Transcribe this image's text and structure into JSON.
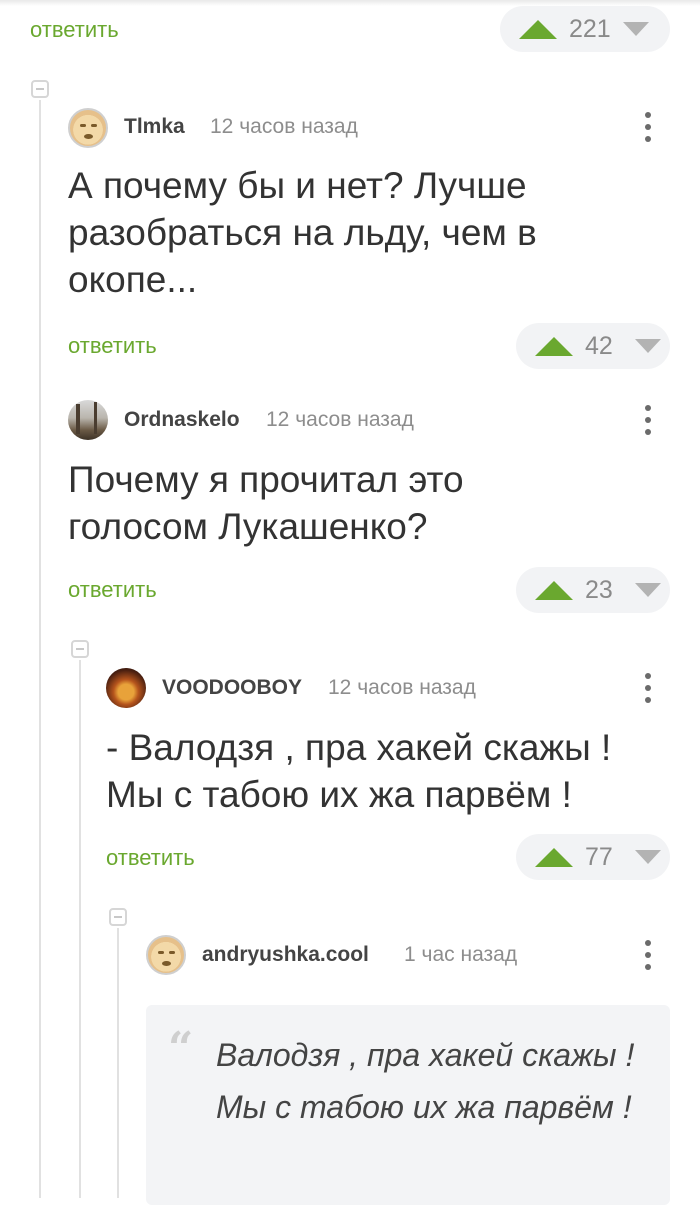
{
  "reply_label": "ответить",
  "colors": {
    "accent_green": "#6aa82f",
    "vote_bg": "#f2f3f5",
    "quote_bg": "#f3f4f6"
  },
  "top": {
    "votes": "221"
  },
  "comments": [
    {
      "user": "Tlmka",
      "time": "12 часов назад",
      "text": "А почему бы и нет? Лучше разобраться на льду, чем в окопе...",
      "votes": "42",
      "avatar_icon": "sleepy-face-avatar"
    },
    {
      "user": "Ordnaskelo",
      "time": "12 часов назад",
      "text": "Почему я прочитал это голосом Лукашенко?",
      "votes": "23",
      "avatar_icon": "forest-photo-avatar"
    },
    {
      "user": "VOODOOBOY",
      "time": "12 часов назад",
      "text": "- Валодзя , пра хакей скажы ! Мы с табою их жа парвём !",
      "votes": "77",
      "avatar_icon": "fire-photo-avatar"
    },
    {
      "user": "andryushka.cool",
      "time": "1 час назад",
      "quote": "Валодзя , пра хакей скажы ! Мы с табою их жа парвём !",
      "avatar_icon": "sleepy-face-avatar"
    }
  ]
}
